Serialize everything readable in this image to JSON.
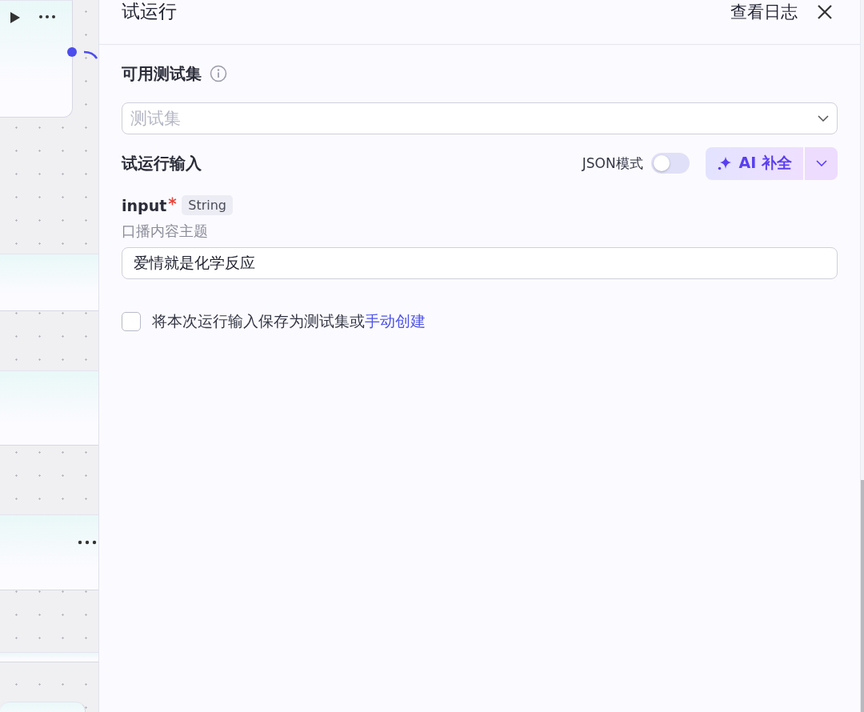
{
  "panel": {
    "title": "试运行",
    "view_log": "查看日志"
  },
  "test_set": {
    "label": "可用测试集",
    "placeholder": "测试集"
  },
  "run_input": {
    "label": "试运行输入",
    "json_mode": {
      "label": "JSON模式",
      "on": false
    },
    "ai_button": "AI 补全"
  },
  "params": [
    {
      "name": "input",
      "required": true,
      "type": "String",
      "description": "口播内容主题",
      "value": "爱情就是化学反应"
    }
  ],
  "save": {
    "checked": false,
    "text": "将本次运行输入保存为测试集或",
    "link": "手动创建"
  }
}
